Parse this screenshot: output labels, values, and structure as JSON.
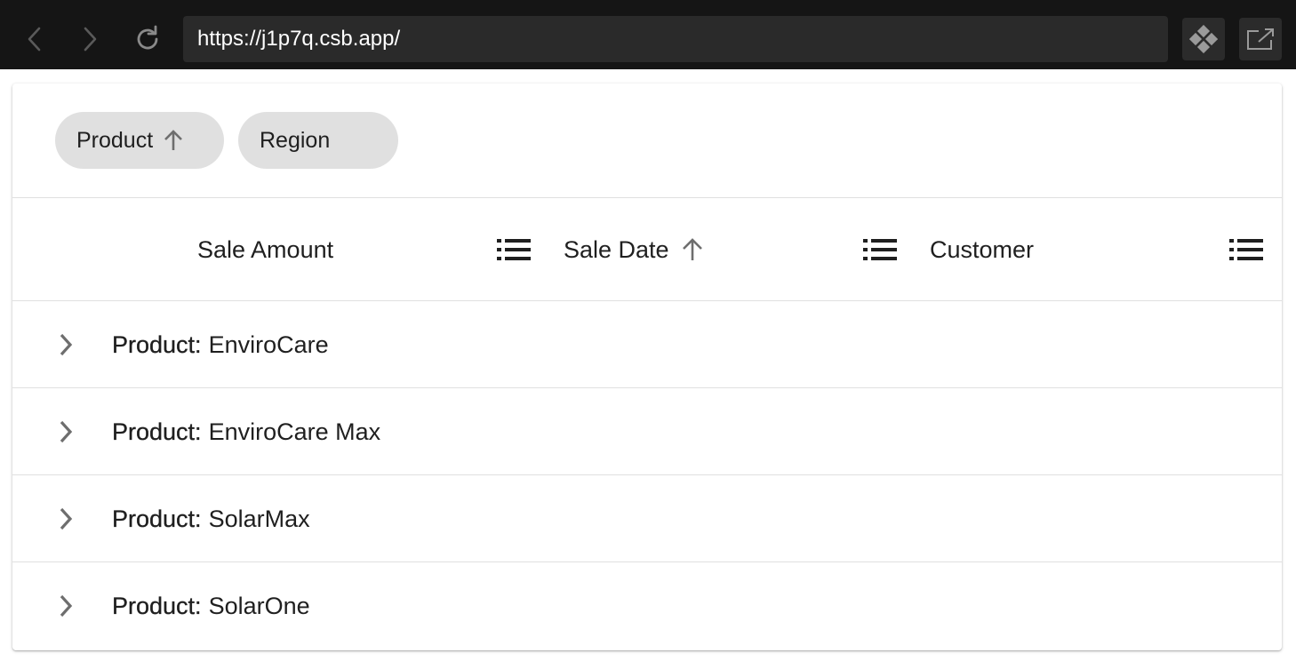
{
  "browser": {
    "url": "https://j1p7q.csb.app/",
    "icons": {
      "back": "chevron-left-icon",
      "forward": "chevron-right-icon",
      "reload": "reload-icon",
      "sandbox": "codesandbox-icon",
      "open": "open-new-window-icon"
    }
  },
  "grouping": {
    "chips": [
      {
        "label": "Product",
        "sort": "ascending"
      },
      {
        "label": "Region",
        "sort": "none"
      }
    ]
  },
  "table": {
    "columns": [
      {
        "label": "Sale Amount",
        "sort": "none"
      },
      {
        "label": "Sale Date",
        "sort": "ascending"
      },
      {
        "label": "Customer",
        "sort": "none"
      }
    ],
    "groups": [
      {
        "key": "Product:",
        "value": "EnviroCare"
      },
      {
        "key": "Product:",
        "value": "EnviroCare Max"
      },
      {
        "key": "Product:",
        "value": "SolarMax"
      },
      {
        "key": "Product:",
        "value": "SolarOne"
      }
    ]
  },
  "colors": {
    "chrome_bg": "#151515",
    "url_bar_bg": "#2a2a2a",
    "chip_bg": "#e0e0e0",
    "text": "#1f1f1f",
    "icon_gray": "#6e6e6e",
    "divider": "#e0e0e0"
  }
}
